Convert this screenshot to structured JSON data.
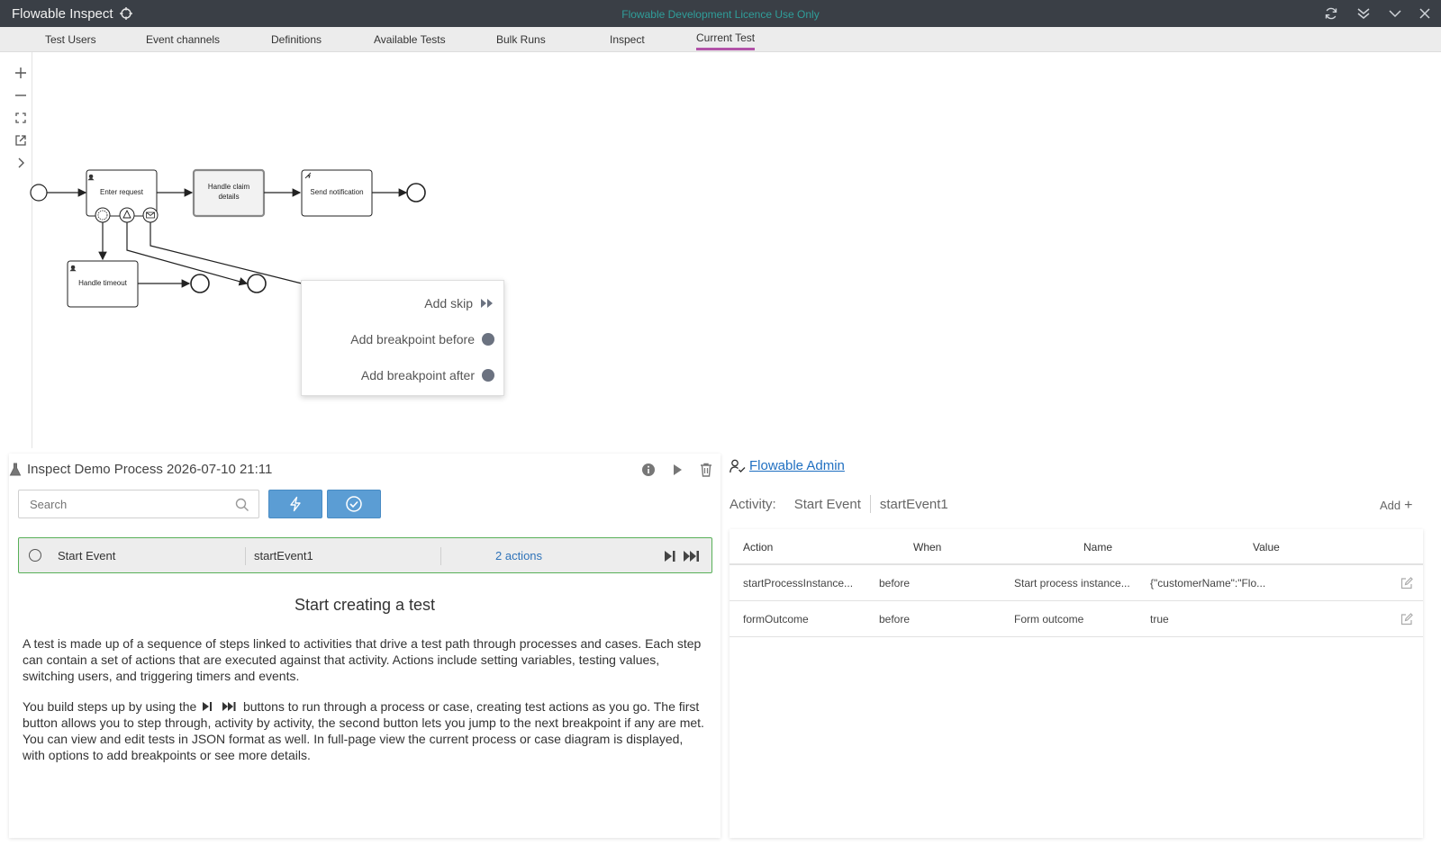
{
  "window": {
    "title": "Flowable Inspect",
    "licence_notice": "Flowable Development Licence Use Only"
  },
  "tabs": [
    {
      "label": "Test Users"
    },
    {
      "label": "Event channels"
    },
    {
      "label": "Definitions"
    },
    {
      "label": "Available Tests"
    },
    {
      "label": "Bulk Runs"
    },
    {
      "label": "Inspect"
    },
    {
      "label": "Current Test",
      "active": true
    }
  ],
  "diagram": {
    "nodes": {
      "enter_request": "Enter request",
      "handle_claim": "Handle claim details",
      "send_notification": "Send notification",
      "handle_timeout": "Handle timeout"
    },
    "context_menu": {
      "add_skip": "Add skip",
      "add_breakpoint_before": "Add breakpoint before",
      "add_breakpoint_after": "Add breakpoint after"
    }
  },
  "test": {
    "title": "Inspect Demo Process 2026-07-10 21:11",
    "search_placeholder": "Search",
    "steps": [
      {
        "name": "Start Event",
        "id": "startEvent1",
        "actions": "2 actions"
      }
    ],
    "help": {
      "title": "Start creating a test",
      "p1": "A test is made up of a sequence of steps linked to activities that drive a test path through processes and cases. Each step can contain a set of actions that are executed against that activity. Actions include setting variables, testing values, switching users, and triggering timers and events.",
      "p2_before": "You build steps up by using the",
      "p2_after": "buttons to run through a process or case, creating test actions as you go. The first button allows you to step through, activity by activity, the second button lets you jump to the next breakpoint if any are met. You can view and edit tests in JSON format as well. In full-page view the current process or case diagram is displayed, with options to add breakpoints or see more details."
    }
  },
  "detail": {
    "user": "Flowable Admin",
    "activity_label": "Activity:",
    "activity_name": "Start Event",
    "activity_id": "startEvent1",
    "add_label": "Add",
    "columns": [
      "Action",
      "When",
      "Name",
      "Value"
    ],
    "rows": [
      {
        "action": "startProcessInstance...",
        "when": "before",
        "name": "Start process instance...",
        "value": "{\"customerName\":\"Flo..."
      },
      {
        "action": "formOutcome",
        "when": "before",
        "name": "Form outcome",
        "value": "true"
      }
    ]
  },
  "colors": {
    "titlebar": "#3a3f46",
    "accent_tab": "#b252a8",
    "primary_button": "#5b9dd4",
    "link": "#1f6fc1",
    "success_border": "#58b058"
  }
}
